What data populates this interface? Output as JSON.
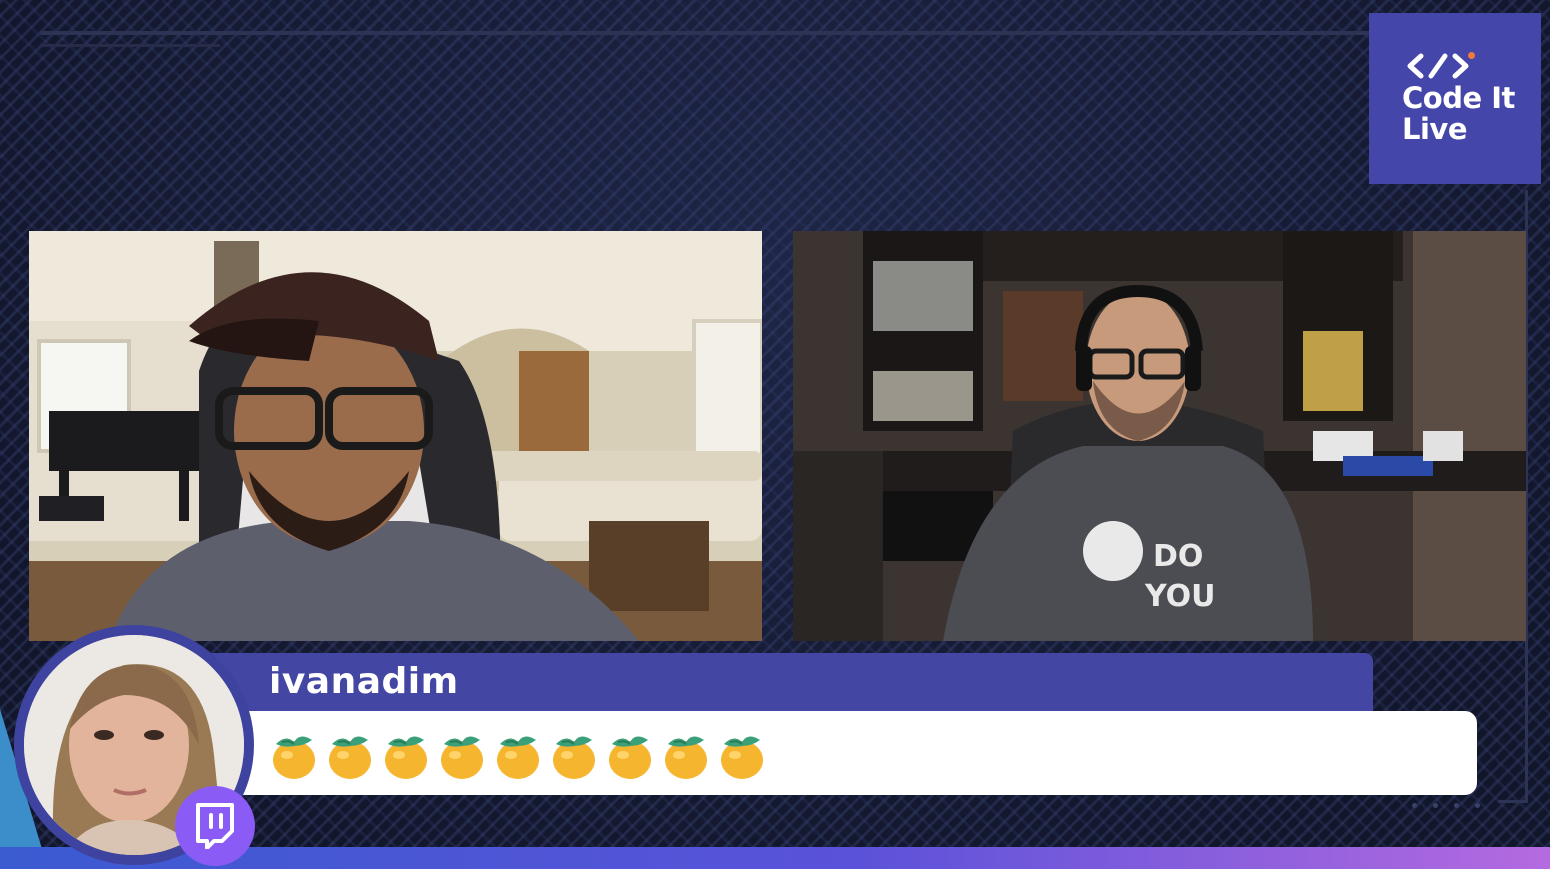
{
  "brand": {
    "logo_line1": "Code It",
    "logo_line2": "Live",
    "logo_color": "#4546a9"
  },
  "video_feeds": [
    {
      "id": "host-left",
      "description_icon": "person-video-feed"
    },
    {
      "id": "host-right",
      "description_icon": "person-video-feed"
    }
  ],
  "chat_message": {
    "username": "ivanadim",
    "emote_name": "orange-emote",
    "emote_count": 9,
    "platform_icon": "twitch-icon"
  },
  "colors": {
    "name_bar": "#4346a2",
    "twitch": "#8a5cf5",
    "accent_gradient_start": "#3b5bd1",
    "accent_gradient_end": "#b56ae0"
  }
}
